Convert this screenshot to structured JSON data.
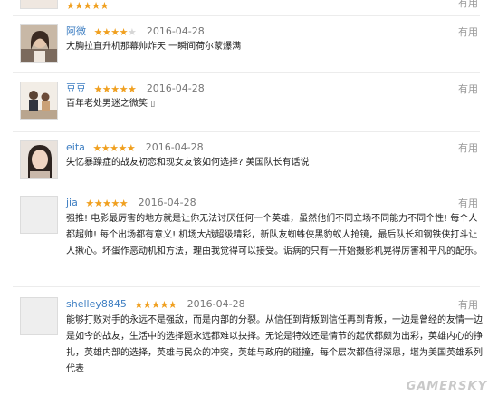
{
  "partial_top": {
    "stars": 5,
    "useful": "有用"
  },
  "comments": [
    {
      "user": "阿微",
      "stars": 4,
      "date": "2016-04-28",
      "useful": "有用",
      "text": "大胸拉直升机那幕帅炸天 一瞬间荷尔蒙爆满",
      "avatar": "girl-photo"
    },
    {
      "user": "豆豆",
      "stars": 5,
      "date": "2016-04-28",
      "useful": "有用",
      "text": "百年老处男迷之微笑",
      "avatar": "couple-photo"
    },
    {
      "user": "eita",
      "stars": 5,
      "date": "2016-04-28",
      "useful": "有用",
      "text": "失忆暴躁症的战友初恋和现女友该如何选择? 美国队长有话说",
      "avatar": "woman-photo"
    },
    {
      "user": "jia",
      "stars": 5,
      "date": "2016-04-28",
      "useful": "有用",
      "text": "强推! 电影最厉害的地方就是让你无法讨厌任何一个英雄，虽然他们不同立场不同能力不同个性! 每个人都超帅! 每个出场都有意义! 机场大战超级精彩，新队友蜘蛛侠黑豹蚁人抢镜，最后队长和钢铁侠打斗让人揪心。坏蛋作恶动机和方法，理由我觉得可以接受。诟病的只有一开始摄影机晃得厉害和平凡的配乐。",
      "avatar": "default"
    },
    {
      "user": "shelley8845",
      "stars": 5,
      "date": "2016-04-28",
      "useful": "有用",
      "text": "能够打败对手的永远不是强敌，而是内部的分裂。从信任到背叛到信任再到背叛，一边是曾经的友情一边是如今的战友，生活中的选择题永远都难以抉择。无论是特效还是情节的起伏都颇为出彩，英雄内心的挣扎，英雄内部的选择，英雄与民众的冲突，英雄与政府的碰撞，每个层次都值得深思，堪为美国英雄系列代表",
      "avatar": "default"
    }
  ],
  "watermark": "GAMERSKY"
}
